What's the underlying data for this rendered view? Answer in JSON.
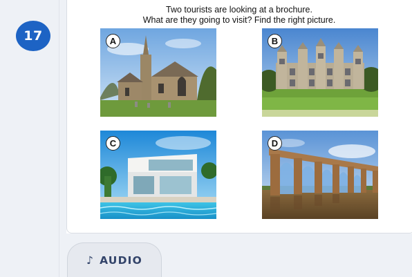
{
  "question": {
    "number": "17",
    "line1": "Two tourists are looking at a brochure.",
    "line2": "What are they going to visit? Find the right picture."
  },
  "pictures": [
    {
      "letter": "A",
      "icon": "church-icon"
    },
    {
      "letter": "B",
      "icon": "manor-house-icon"
    },
    {
      "letter": "C",
      "icon": "modern-villa-icon"
    },
    {
      "letter": "D",
      "icon": "viaduct-icon"
    }
  ],
  "audio": {
    "icon": "music-note-icon",
    "glyph": "♪",
    "label": "AUDIO"
  }
}
